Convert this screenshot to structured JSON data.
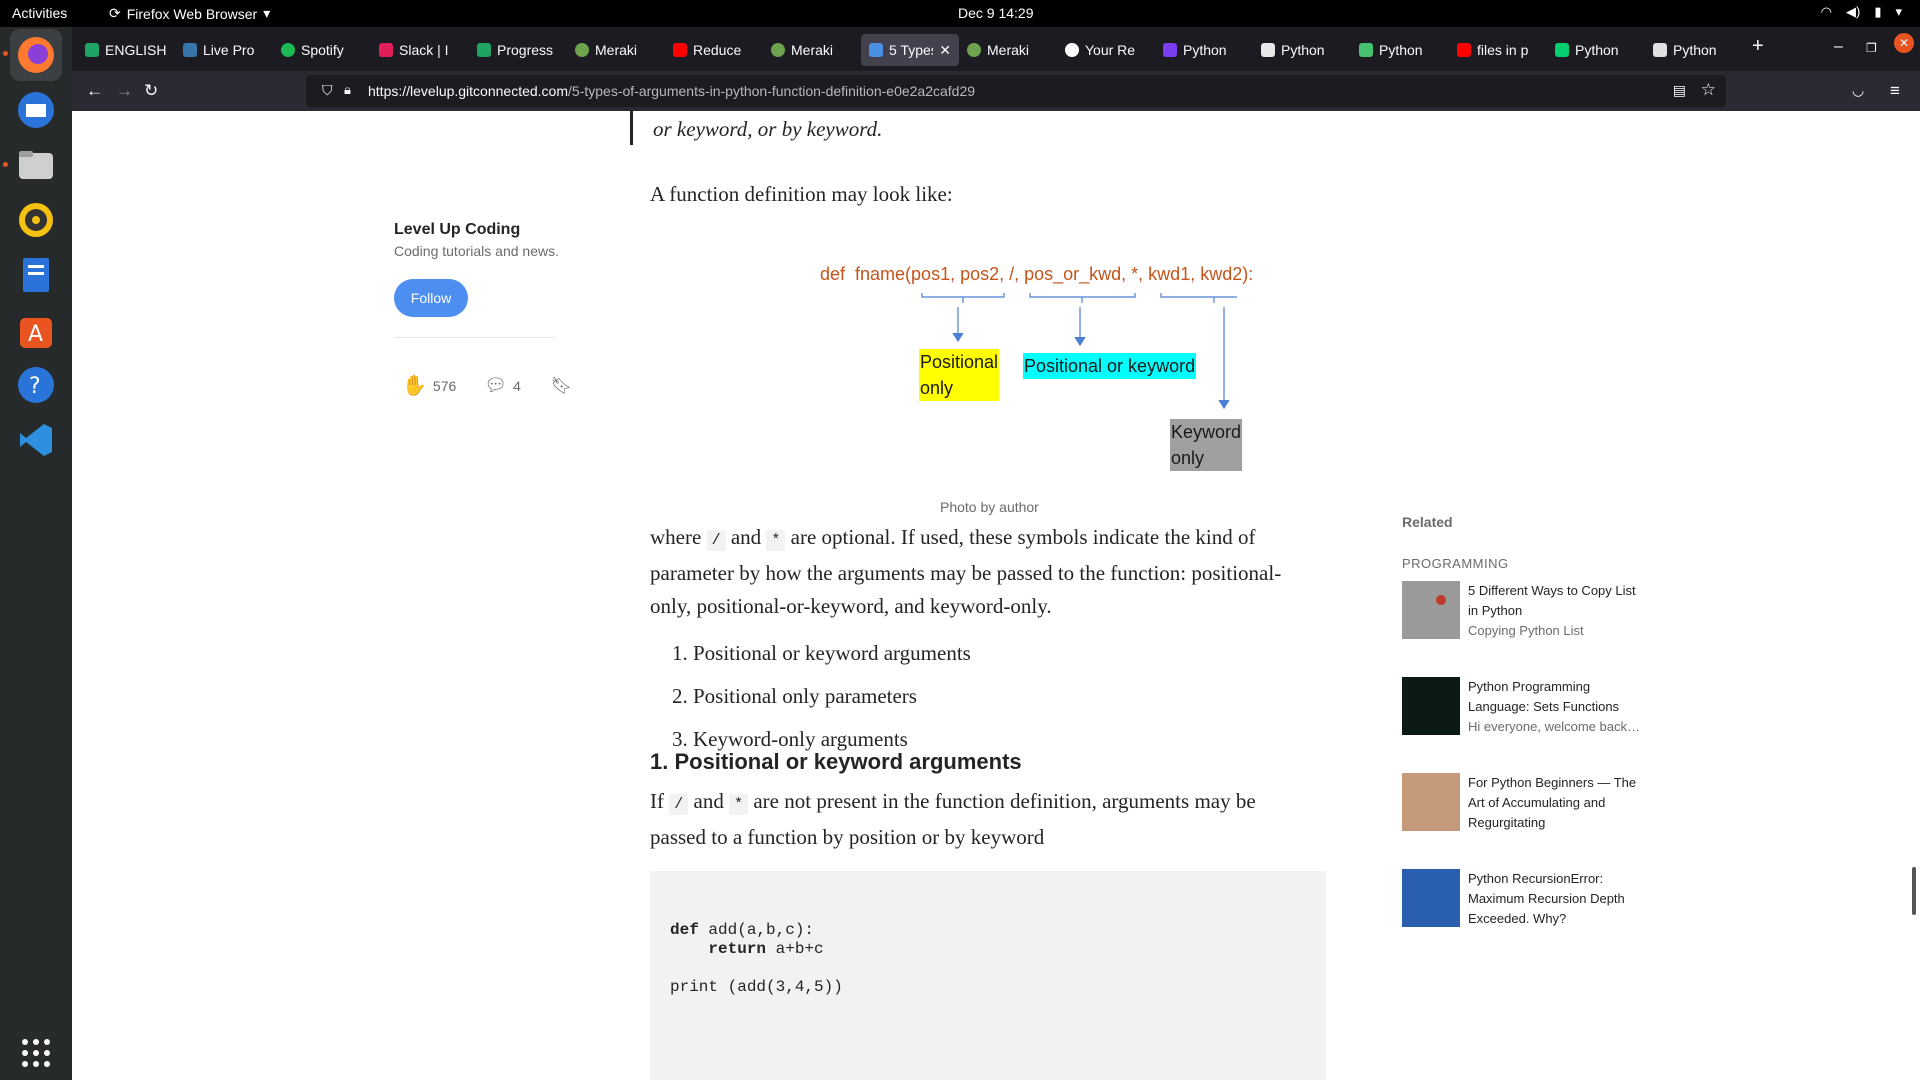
{
  "topbar": {
    "activities": "Activities",
    "app_name": "Firefox Web Browser",
    "clock": "Dec 9  14:29"
  },
  "tabs": [
    {
      "label": "ENGLISH",
      "color": "#1fa463"
    },
    {
      "label": "Live Pro",
      "color": "#3776ab"
    },
    {
      "label": "Spotify",
      "color": "#1db954"
    },
    {
      "label": "Slack | I",
      "color": "#e01e5a"
    },
    {
      "label": "Progress",
      "color": "#1fa463"
    },
    {
      "label": "Meraki",
      "color": "#6da34d"
    },
    {
      "label": "Reduce",
      "color": "#ff0000"
    },
    {
      "label": "Meraki",
      "color": "#6da34d"
    },
    {
      "label": "5 Types",
      "color": "#4a90e2"
    },
    {
      "label": "Meraki",
      "color": "#6da34d"
    },
    {
      "label": "Your Re",
      "color": "#ffffff"
    },
    {
      "label": "Python",
      "color": "#7b3ff2"
    },
    {
      "label": "Python",
      "color": "#e8e8e8"
    },
    {
      "label": "Python",
      "color": "#46c36f"
    },
    {
      "label": "files in p",
      "color": "#ff0000"
    },
    {
      "label": "Python",
      "color": "#05ce6f"
    },
    {
      "label": "Python",
      "color": "#e0e0e0"
    }
  ],
  "address": {
    "url_domain": "https://levelup.gitconnected.com",
    "url_path": "/5-types-of-arguments-in-python-function-definition-e0e2a2cafd29"
  },
  "article": {
    "quote_tail": "or keyword, or by keyword.",
    "intro": "A function definition may look like:",
    "figure": {
      "definition": "def  fname(pos1, pos2, /, pos_or_kwd, *, kwd1, kwd2):",
      "label_positional_only_1": "Positional",
      "label_positional_only_2": "only",
      "label_positional_or_keyword": "Positional or keyword",
      "label_keyword_only": "Keyword only",
      "colors": {
        "positional_only": "#ffff00",
        "positional_or_keyword": "#00ffff",
        "keyword_only": "#a0a0a0",
        "def_text": "#c5541a"
      }
    },
    "caption": "Photo by author",
    "where_p1": "where ",
    "slash": "/",
    "and_word": " and ",
    "star": "*",
    "where_p2": " are optional. If used, these symbols indicate the kind of parameter by how the arguments may be passed to the function: positional-only, positional-or-keyword, and keyword-only.",
    "list": [
      "1. Positional or keyword arguments",
      "2. Positional only parameters",
      "3. Keyword-only arguments"
    ],
    "section_heading": "1. Positional or keyword arguments",
    "if_p1": "If ",
    "if_p2": " are not present in the function definition, arguments may be passed to a function by position or by keyword",
    "code_line1_kw": "def",
    "code_line1_rest": " add(a,b,c):",
    "code_line2_kw": "return",
    "code_line2_rest": " a+b+c",
    "code_line3": "print (add(3,4,5))"
  },
  "publication": {
    "name": "Level Up Coding",
    "description": "Coding tutorials and news.",
    "follow": "Follow",
    "claps": "576",
    "responses": "4"
  },
  "related": {
    "title": "Related",
    "tag": "PROGRAMMING",
    "items": [
      {
        "title": "5 Different Ways to Copy List in Python",
        "subtitle": "Copying Python List"
      },
      {
        "title": "Python Programming Language: Sets Functions",
        "subtitle": "Hi everyone, welcome back…"
      },
      {
        "title": "For Python Beginners — The Art of Accumulating and Regurgitating",
        "subtitle": ""
      },
      {
        "title": "Python RecursionError: Maximum Recursion Depth Exceeded. Why?",
        "subtitle": ""
      }
    ]
  }
}
